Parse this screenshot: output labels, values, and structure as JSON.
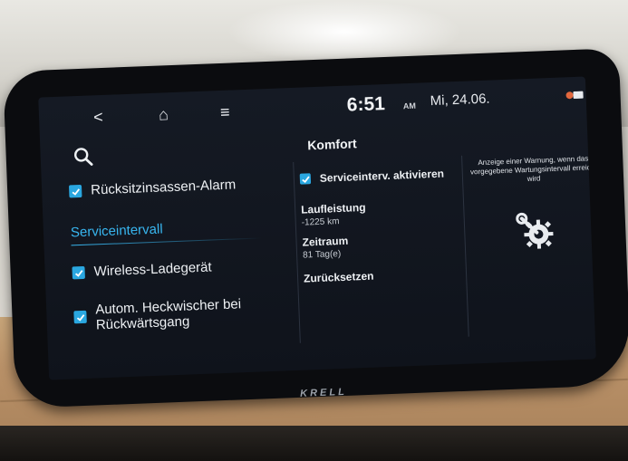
{
  "status": {
    "back_icon": "<",
    "home_icon": "⌂",
    "menu_icon": "≡",
    "time": "6:51",
    "ampm": "AM",
    "date": "Mi, 24.06."
  },
  "title": "Komfort",
  "left_column": {
    "rear_seat_alarm": "Rücksitzinsassen-Alarm",
    "section": "Serviceintervall",
    "wireless_charger": "Wireless-Ladegerät",
    "rear_wiper": "Autom. Heckwischer bei Rückwärtsgang"
  },
  "middle_column": {
    "service_enable": "Serviceinterv. aktivieren",
    "mileage_label": "Laufleistung",
    "mileage_value": "-1225 km",
    "period_label": "Zeitraum",
    "period_value": "81 Tag(e)",
    "reset": "Zurücksetzen"
  },
  "help": {
    "text": "Anzeige einer Warnung, wenn das vorgegebene Wartungsintervall erreicht wird"
  },
  "brand": "KRELL",
  "colors": {
    "accent": "#38b6f0",
    "checkbox": "#2aa7e0",
    "screen_bg": "#121722"
  }
}
